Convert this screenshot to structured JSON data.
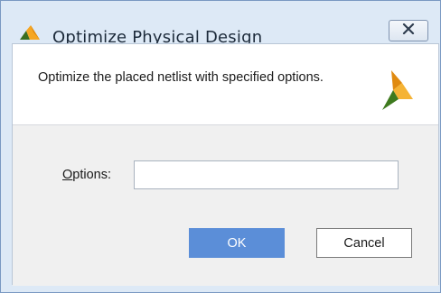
{
  "window": {
    "title": "Optimize Physical Design",
    "icon": "vivado-logo-icon",
    "close_icon": "close-icon",
    "accent_color": "#f5a623"
  },
  "header": {
    "description": "Optimize the placed netlist with specified options.",
    "logo": "vivado-logo-icon"
  },
  "form": {
    "options_label_mnemonic": "O",
    "options_label_rest": "ptions:",
    "options_value": "",
    "options_placeholder": ""
  },
  "buttons": {
    "ok_label": "OK",
    "cancel_label": "Cancel",
    "ok_color": "#5b8ed8"
  }
}
